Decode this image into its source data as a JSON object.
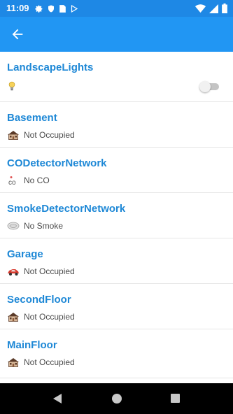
{
  "status_bar": {
    "time": "11:09",
    "left_icons": [
      "gear-icon",
      "shield-icon",
      "sim-card-icon",
      "play-store-icon"
    ],
    "right_icons": [
      "wifi-icon",
      "signal-icon",
      "battery-icon"
    ]
  },
  "app_bar": {
    "back_icon": "arrow-left-icon"
  },
  "devices": [
    {
      "title": "LandscapeLights",
      "icon": "light-bulb-icon",
      "toggle_on": false
    },
    {
      "title": "Basement",
      "status": "Not Occupied",
      "icon": "house-icon"
    },
    {
      "title": "CODetectorNetwork",
      "status": "No CO",
      "icon": "co-icon"
    },
    {
      "title": "SmokeDetectorNetwork",
      "status": "No Smoke",
      "icon": "smoke-detector-icon"
    },
    {
      "title": "Garage",
      "status": "Not Occupied",
      "icon": "car-icon"
    },
    {
      "title": "SecondFloor",
      "status": "Not Occupied",
      "icon": "house-icon"
    },
    {
      "title": "MainFloor",
      "status": "Not Occupied",
      "icon": "house-icon"
    }
  ],
  "nav_bar": {
    "icons": [
      "back-triangle-icon",
      "home-circle-icon",
      "recents-square-icon"
    ]
  },
  "colors": {
    "status_bar": "#1e88e5",
    "app_bar": "#2196f3",
    "title_text": "#1e88d6",
    "status_text": "#4a4a4a"
  }
}
